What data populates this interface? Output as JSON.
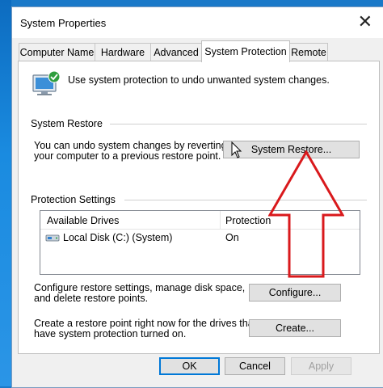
{
  "window": {
    "title": "System Properties",
    "close_symbol": "✕"
  },
  "tabs": [
    {
      "label": "Computer Name"
    },
    {
      "label": "Hardware"
    },
    {
      "label": "Advanced"
    },
    {
      "label": "System Protection",
      "active": true
    },
    {
      "label": "Remote"
    }
  ],
  "intro": "Use system protection to undo unwanted system changes.",
  "system_restore": {
    "group_label": "System Restore",
    "line1": "You can undo system changes by reverting",
    "line2": "your computer to a previous restore point.",
    "button": "System Restore..."
  },
  "protection": {
    "group_label": "Protection Settings",
    "columns": [
      "Available Drives",
      "Protection"
    ],
    "rows": [
      {
        "drive": "Local Disk (C:) (System)",
        "protection": "On"
      }
    ]
  },
  "configure": {
    "line1": "Configure restore settings, manage disk space,",
    "line2": "and delete restore points.",
    "button": "Configure..."
  },
  "create": {
    "line1": "Create a restore point right now for the drives that",
    "line2": "have system protection turned on.",
    "button": "Create..."
  },
  "footer": {
    "ok": "OK",
    "cancel": "Cancel",
    "apply": "Apply"
  },
  "colors": {
    "accent": "#0078d7",
    "annotation_arrow": "#d9191c",
    "desktop": "#1a79c8"
  }
}
